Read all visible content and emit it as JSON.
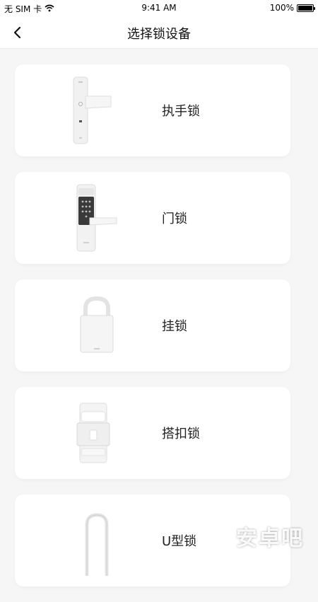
{
  "status_bar": {
    "carrier": "无 SIM 卡",
    "time": "9:41 AM",
    "battery": "100%",
    "battery_level": 1.0,
    "wifi_icon": "wifi-icon"
  },
  "nav": {
    "title": "选择锁设备",
    "back_icon": "chevron-left-icon"
  },
  "devices": [
    {
      "label": "执手锁",
      "icon": "lever-lock-icon"
    },
    {
      "label": "门锁",
      "icon": "door-lock-icon"
    },
    {
      "label": "挂锁",
      "icon": "padlock-icon"
    },
    {
      "label": "搭扣锁",
      "icon": "hasp-lock-icon"
    },
    {
      "label": "U型锁",
      "icon": "u-lock-icon"
    }
  ],
  "watermark": "安卓吧",
  "colors": {
    "background": "#f6f6f7",
    "card": "#ffffff",
    "text": "#222222"
  }
}
